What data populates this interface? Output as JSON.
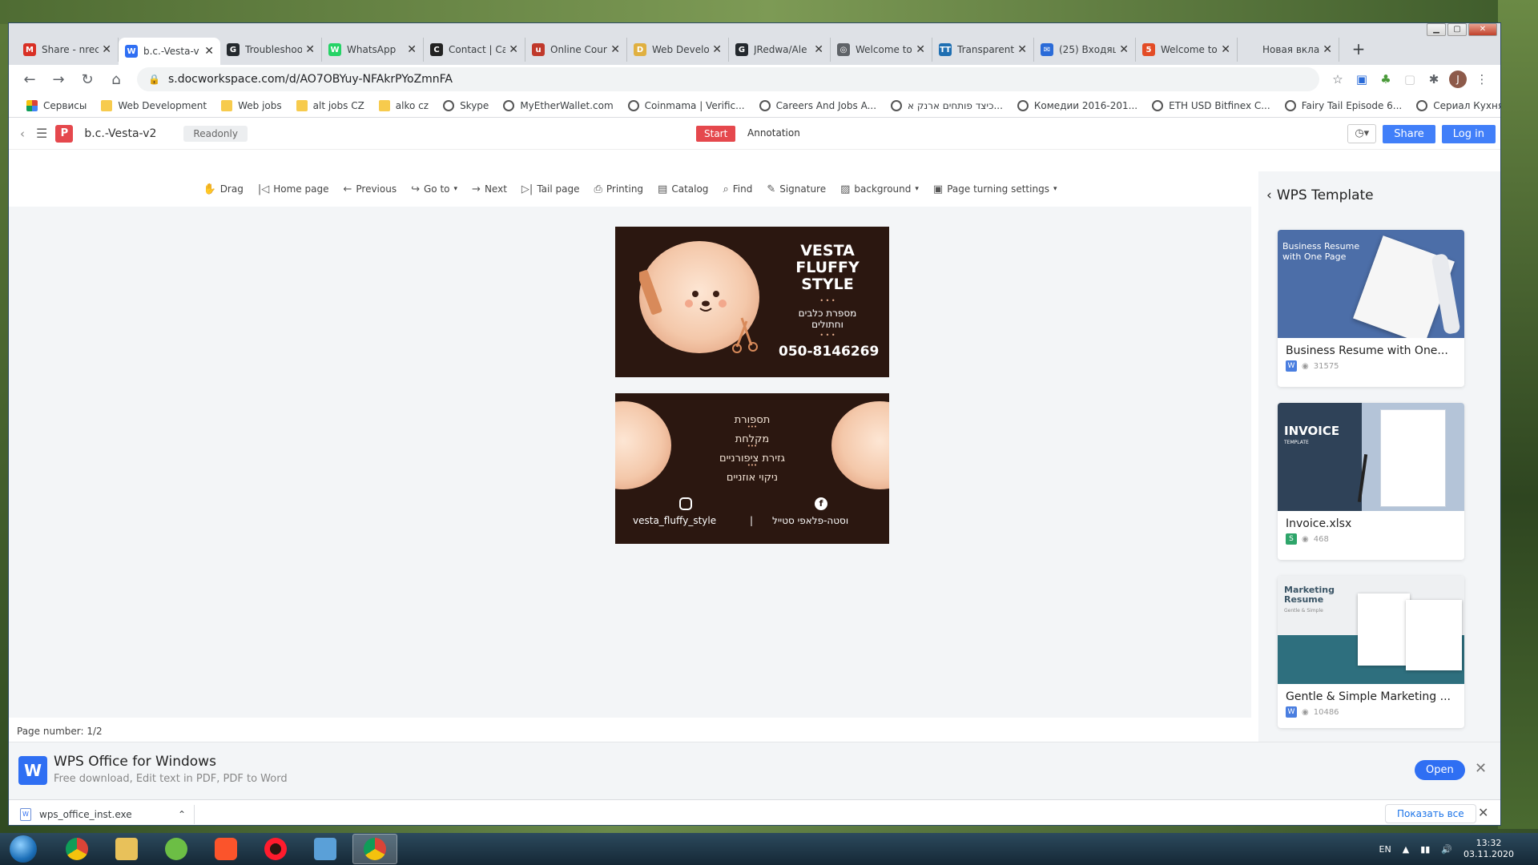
{
  "browser": {
    "tabs": [
      {
        "title": "Share - nreci",
        "icon": "gmail-icon",
        "color": "#d93025",
        "glyph": "M",
        "active": false
      },
      {
        "title": "b.c.-Vesta-v",
        "icon": "wps-icon",
        "color": "#2f6ff3",
        "glyph": "W",
        "active": true
      },
      {
        "title": "Troubleshoo",
        "icon": "github-icon",
        "color": "#24292e",
        "glyph": "G",
        "active": false
      },
      {
        "title": "WhatsApp",
        "icon": "whatsapp-icon",
        "color": "#25d366",
        "glyph": "W",
        "active": false
      },
      {
        "title": "Contact | Ca",
        "icon": "c-logo-icon",
        "color": "#222222",
        "glyph": "C",
        "active": false
      },
      {
        "title": "Online Cour",
        "icon": "udemy-icon",
        "color": "#c0392b",
        "glyph": "u",
        "active": false
      },
      {
        "title": "Web Develo",
        "icon": "doc-icon",
        "color": "#e0b040",
        "glyph": "D",
        "active": false
      },
      {
        "title": "JRedwa/Ale",
        "icon": "github-icon",
        "color": "#24292e",
        "glyph": "G",
        "active": false
      },
      {
        "title": "Welcome to",
        "icon": "globe-icon",
        "color": "#5f6368",
        "glyph": "◎",
        "active": false
      },
      {
        "title": "Transparent",
        "icon": "tt-icon",
        "color": "#1f6fb2",
        "glyph": "TT",
        "active": false
      },
      {
        "title": "(25) Входящ",
        "icon": "mail-icon",
        "color": "#2a6bd8",
        "glyph": "✉",
        "active": false
      },
      {
        "title": "Welcome to",
        "icon": "html-icon",
        "color": "#e34c26",
        "glyph": "5",
        "active": false
      },
      {
        "title": "Новая вкладка",
        "icon": "newtab-icon",
        "color": "#dee1e6",
        "glyph": "",
        "active": false
      }
    ],
    "url": "s.docworkspace.com/d/AO7OBYuy-NFAkrPYoZmnFA",
    "bookmarks": [
      {
        "label": "Сервисы",
        "kind": "apps"
      },
      {
        "label": "Web Development",
        "kind": "folder"
      },
      {
        "label": "Web jobs",
        "kind": "folder"
      },
      {
        "label": "alt jobs CZ",
        "kind": "folder"
      },
      {
        "label": "alko cz",
        "kind": "folder"
      },
      {
        "label": "Skype",
        "kind": "globe"
      },
      {
        "label": "MyEtherWallet.com",
        "kind": "globe"
      },
      {
        "label": "Coinmama | Verific...",
        "kind": "globe"
      },
      {
        "label": "Careers And Jobs A...",
        "kind": "globe"
      },
      {
        "label": "כיצד פותחים ארנק א...",
        "kind": "globe"
      },
      {
        "label": "Комедии 2016-201...",
        "kind": "globe"
      },
      {
        "label": "ETH USD Bitfinex C...",
        "kind": "globe"
      },
      {
        "label": "Fairy Tail Episode 6...",
        "kind": "globe"
      },
      {
        "label": "Сериал Кухня все с...",
        "kind": "globe"
      }
    ],
    "more": "»"
  },
  "app": {
    "doc_title": "b.c.-Vesta-v2",
    "readonly": "Readonly",
    "start": "Start",
    "annotation": "Annotation",
    "share": "Share",
    "login": "Log in",
    "tools": [
      {
        "label": "Drag",
        "icon": "hand-icon",
        "glyph": "✋"
      },
      {
        "label": "Home page",
        "icon": "first-page-icon",
        "glyph": "|◁"
      },
      {
        "label": "Previous",
        "icon": "arrow-left-icon",
        "glyph": "←"
      },
      {
        "label": "Go to",
        "icon": "goto-icon",
        "glyph": "↪"
      },
      {
        "label": "Next",
        "icon": "arrow-right-icon",
        "glyph": "→"
      },
      {
        "label": "Tail page",
        "icon": "last-page-icon",
        "glyph": "▷|"
      },
      {
        "label": "Printing",
        "icon": "printer-icon",
        "glyph": "⎙"
      },
      {
        "label": "Catalog",
        "icon": "catalog-icon",
        "glyph": "▤"
      },
      {
        "label": "Find",
        "icon": "search-icon",
        "glyph": "⌕"
      },
      {
        "label": "Signature",
        "icon": "pen-icon",
        "glyph": "✎"
      },
      {
        "label": "background",
        "icon": "background-icon",
        "glyph": "▨"
      },
      {
        "label": "Page turning settings",
        "icon": "settings-icon",
        "glyph": "▣"
      }
    ],
    "page_number": "Page number: 1/2"
  },
  "card_front": {
    "brand_lines": [
      "VESTA",
      "FLUFFY",
      "STYLE"
    ],
    "dots": "• • •",
    "hebrew_line1": "מספרת כלבים",
    "hebrew_line2": "וחתולים",
    "phone": "050-8146269"
  },
  "card_back": {
    "services": [
      "תספורת",
      "מקלחת",
      "גזירת ציפורניים",
      "ניקוי אוזניים"
    ],
    "separator": "•••",
    "instagram": "vesta_fluffy_style",
    "divider": "|",
    "facebook": "וסטה-פלאפי סטייל"
  },
  "sidebar": {
    "title": "WPS Template",
    "templates": [
      {
        "name": "Business Resume with One...",
        "views": "31575",
        "ftype": "W",
        "fcolor": "#4a7ee0",
        "thumb_title": "Business Resume with One Page"
      },
      {
        "name": "Invoice.xlsx",
        "views": "468",
        "ftype": "S",
        "fcolor": "#2ea56a",
        "thumb_title": "INVOICE",
        "thumb_sub": "TEMPLATE"
      },
      {
        "name": "Gentle & Simple Marketing ...",
        "views": "10486",
        "ftype": "W",
        "fcolor": "#4a7ee0",
        "thumb_title": "Marketing Resume",
        "thumb_sub": "Gentle & Simple"
      }
    ]
  },
  "banner": {
    "title": "WPS Office for Windows",
    "subtitle": "Free download, Edit text in PDF, PDF to Word",
    "open": "Open"
  },
  "download": {
    "file": "wps_office_inst.exe",
    "show_all": "Показать все"
  },
  "taskbar": {
    "lang": "EN",
    "time": "13:32",
    "date": "03.11.2020"
  }
}
